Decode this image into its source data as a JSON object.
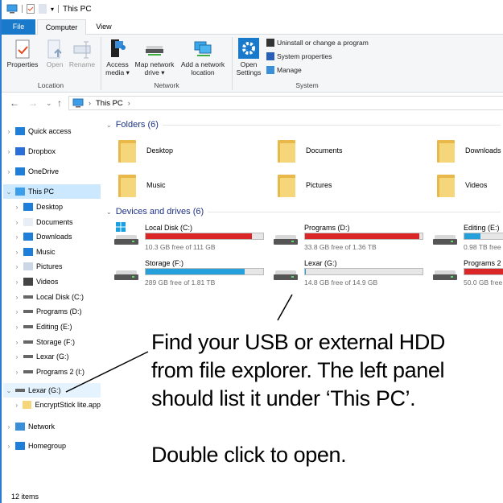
{
  "title_bar": {
    "title": "This PC",
    "icons": [
      "computer-icon",
      "properties-icon",
      "new-folder-icon",
      "customize-dropdown-icon"
    ]
  },
  "ribbon_tabs": [
    {
      "label": "File",
      "active": false
    },
    {
      "label": "Computer",
      "active": true
    },
    {
      "label": "View",
      "active": false
    }
  ],
  "ribbon": {
    "location": {
      "label": "Location",
      "buttons": [
        {
          "label": "Properties",
          "enabled": true
        },
        {
          "label": "Open",
          "enabled": false
        },
        {
          "label": "Rename",
          "enabled": false
        }
      ]
    },
    "network": {
      "label": "Network",
      "buttons": [
        {
          "line1": "Access",
          "line2": "media ▾"
        },
        {
          "line1": "Map network",
          "line2": "drive ▾"
        },
        {
          "line1": "Add a network",
          "line2": "location"
        }
      ]
    },
    "system": {
      "label": "System",
      "open_settings": {
        "line1": "Open",
        "line2": "Settings"
      },
      "items": [
        "Uninstall or change a program",
        "System properties",
        "Manage"
      ]
    }
  },
  "address_bar": {
    "path": "This PC",
    "back": "←",
    "forward": "→",
    "recent": "⌄",
    "up": "↑"
  },
  "nav_pane": {
    "items": [
      {
        "label": "Quick access",
        "icon": "star-icon"
      },
      {
        "label": "Dropbox",
        "icon": "dropbox-icon"
      },
      {
        "label": "OneDrive",
        "icon": "cloud-icon"
      },
      {
        "label": "This PC",
        "icon": "computer-icon",
        "selected": true
      },
      {
        "label": "Desktop",
        "icon": "desktop-icon"
      },
      {
        "label": "Documents",
        "icon": "documents-icon"
      },
      {
        "label": "Downloads",
        "icon": "download-arrow-icon"
      },
      {
        "label": "Music",
        "icon": "music-note-icon"
      },
      {
        "label": "Pictures",
        "icon": "pictures-icon"
      },
      {
        "label": "Videos",
        "icon": "videos-icon"
      },
      {
        "label": "Local Disk (C:)",
        "icon": "drive-icon"
      },
      {
        "label": "Programs (D:)",
        "icon": "drive-icon"
      },
      {
        "label": "Editing (E:)",
        "icon": "drive-icon"
      },
      {
        "label": "Storage (F:)",
        "icon": "drive-icon"
      },
      {
        "label": "Lexar (G:)",
        "icon": "drive-icon"
      },
      {
        "label": "Programs 2 (I:)",
        "icon": "drive-icon"
      },
      {
        "label": "Lexar (G:)",
        "icon": "drive-icon",
        "highlighted": true
      },
      {
        "label": "EncryptStick lite.app",
        "icon": "folder-icon"
      },
      {
        "label": "Network",
        "icon": "network-icon"
      },
      {
        "label": "Homegroup",
        "icon": "homegroup-icon"
      }
    ]
  },
  "folders": {
    "header": "Folders (6)",
    "items": [
      "Desktop",
      "Documents",
      "Downloads",
      "Music",
      "Pictures",
      "Videos"
    ]
  },
  "devices": {
    "header": "Devices and drives (6)",
    "items": [
      {
        "name": "Local Disk (C:)",
        "free": "10.3 GB free of 111 GB",
        "used_percent": 90.7,
        "color": "#da2626"
      },
      {
        "name": "Programs (D:)",
        "free": "33.8 GB free of 1.36 TB",
        "used_percent": 97.6,
        "color": "#da2626"
      },
      {
        "name": "Editing (E:)",
        "free": "0.98 TB free",
        "used_percent": 40,
        "color": "#26a0da"
      },
      {
        "name": "Storage (F:)",
        "free": "289 GB free of 1.81 TB",
        "used_percent": 84,
        "color": "#26a0da"
      },
      {
        "name": "Lexar (G:)",
        "free": "14.8 GB free of 14.9 GB",
        "used_percent": 0.7,
        "color": "#26a0da"
      },
      {
        "name": "Programs 2",
        "free": "50.0 GB free",
        "used_percent": 95,
        "color": "#da2626"
      }
    ]
  },
  "annotation": {
    "line1": "Find your USB or external HDD",
    "line2": "from file explorer. The left panel",
    "line3": "should list it under ‘This PC’.",
    "line4": "Double click to open."
  },
  "status_bar": {
    "items": "12 items"
  },
  "colors": {
    "accent": "#1979ca",
    "selection": "#cce8ff",
    "bar_red": "#da2626",
    "bar_blue": "#26a0da"
  }
}
